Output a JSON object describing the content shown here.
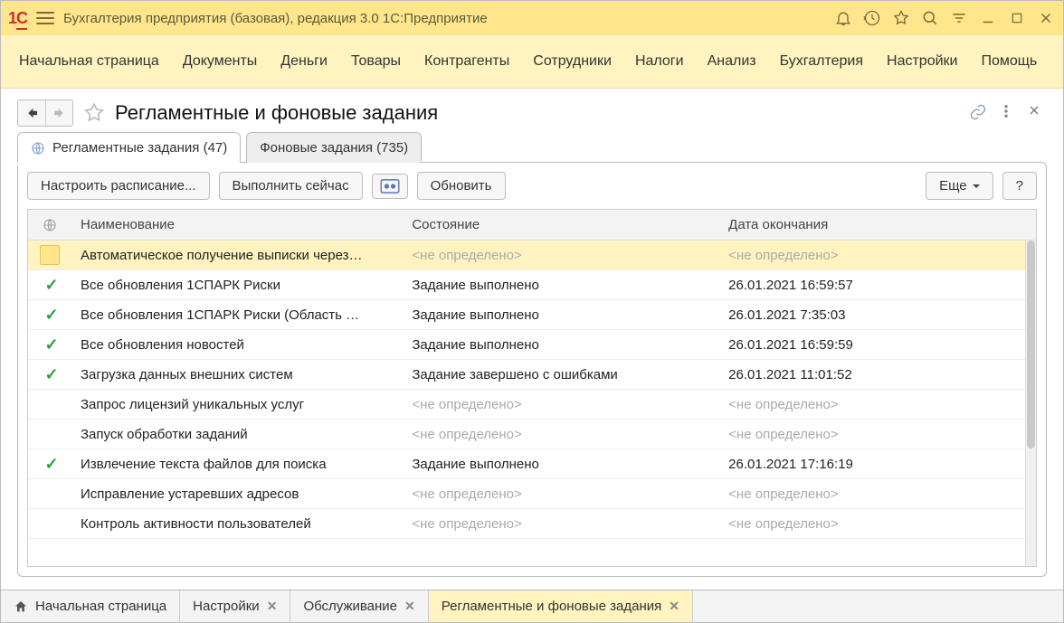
{
  "titlebar": {
    "title": "Бухгалтерия предприятия (базовая), редакция 3.0 1С:Предприятие"
  },
  "main_menu": [
    "Начальная страница",
    "Документы",
    "Деньги",
    "Товары",
    "Контрагенты",
    "Сотрудники",
    "Налоги",
    "Анализ",
    "Бухгалтерия",
    "Настройки",
    "Помощь"
  ],
  "page": {
    "title": "Регламентные и фоновые задания"
  },
  "tabs": {
    "scheduled": {
      "label": "Регламентные задания (47)",
      "active": true
    },
    "background": {
      "label": "Фоновые задания (735)",
      "active": false
    }
  },
  "toolbar": {
    "schedule": "Настроить расписание...",
    "run_now": "Выполнить сейчас",
    "refresh": "Обновить",
    "more": "Еще",
    "help": "?"
  },
  "table": {
    "columns": {
      "name": "Наименование",
      "state": "Состояние",
      "end": "Дата окончания"
    },
    "undefined_text": "<не определено>",
    "rows": [
      {
        "selected": true,
        "done": false,
        "name": "Автоматическое получение выписки через…",
        "state": "<не определено>",
        "end": "<не определено>"
      },
      {
        "selected": false,
        "done": true,
        "name": "Все обновления 1СПАРК Риски",
        "state": "Задание выполнено",
        "end": "26.01.2021 16:59:57"
      },
      {
        "selected": false,
        "done": true,
        "name": "Все обновления 1СПАРК Риски (Область …",
        "state": "Задание выполнено",
        "end": "26.01.2021 7:35:03"
      },
      {
        "selected": false,
        "done": true,
        "name": "Все обновления новостей",
        "state": "Задание выполнено",
        "end": "26.01.2021 16:59:59"
      },
      {
        "selected": false,
        "done": true,
        "name": "Загрузка данных внешних систем",
        "state": "Задание завершено с ошибками",
        "end": "26.01.2021 11:01:52"
      },
      {
        "selected": false,
        "done": false,
        "name": "Запрос лицензий уникальных услуг",
        "state": "<не определено>",
        "end": "<не определено>"
      },
      {
        "selected": false,
        "done": false,
        "name": "Запуск обработки заданий",
        "state": "<не определено>",
        "end": "<не определено>"
      },
      {
        "selected": false,
        "done": true,
        "name": "Извлечение текста файлов для поиска",
        "state": "Задание выполнено",
        "end": "26.01.2021 17:16:19"
      },
      {
        "selected": false,
        "done": false,
        "name": "Исправление устаревших адресов",
        "state": "<не определено>",
        "end": "<не определено>"
      },
      {
        "selected": false,
        "done": false,
        "name": "Контроль активности пользователей",
        "state": "<не определено>",
        "end": "<не определено>"
      }
    ]
  },
  "bottom_tabs": [
    {
      "label": "Начальная страница",
      "closable": false,
      "home": true,
      "active": false
    },
    {
      "label": "Настройки",
      "closable": true,
      "home": false,
      "active": false
    },
    {
      "label": "Обслуживание",
      "closable": true,
      "home": false,
      "active": false
    },
    {
      "label": "Регламентные и фоновые задания",
      "closable": true,
      "home": false,
      "active": true
    }
  ]
}
